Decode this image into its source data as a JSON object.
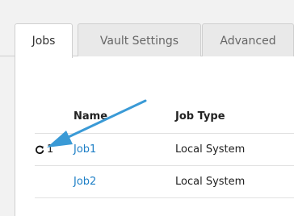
{
  "tabs": [
    {
      "label": "Jobs",
      "active": true
    },
    {
      "label": "Vault Settings",
      "active": false
    },
    {
      "label": "Advanced",
      "active": false
    }
  ],
  "table": {
    "columns": [
      "",
      "Name",
      "Job Type"
    ],
    "rows": [
      {
        "status_icon": "refresh-icon",
        "status_count": "1",
        "name": "Job1",
        "job_type": "Local System"
      },
      {
        "status_icon": "",
        "status_count": "",
        "name": "Job2",
        "job_type": "Local System"
      }
    ]
  },
  "annotation": {
    "icon": "callout-arrow",
    "color": "#3a9ad6"
  },
  "colors": {
    "link": "#1e7fc6",
    "accent": "#3a9ad6"
  }
}
